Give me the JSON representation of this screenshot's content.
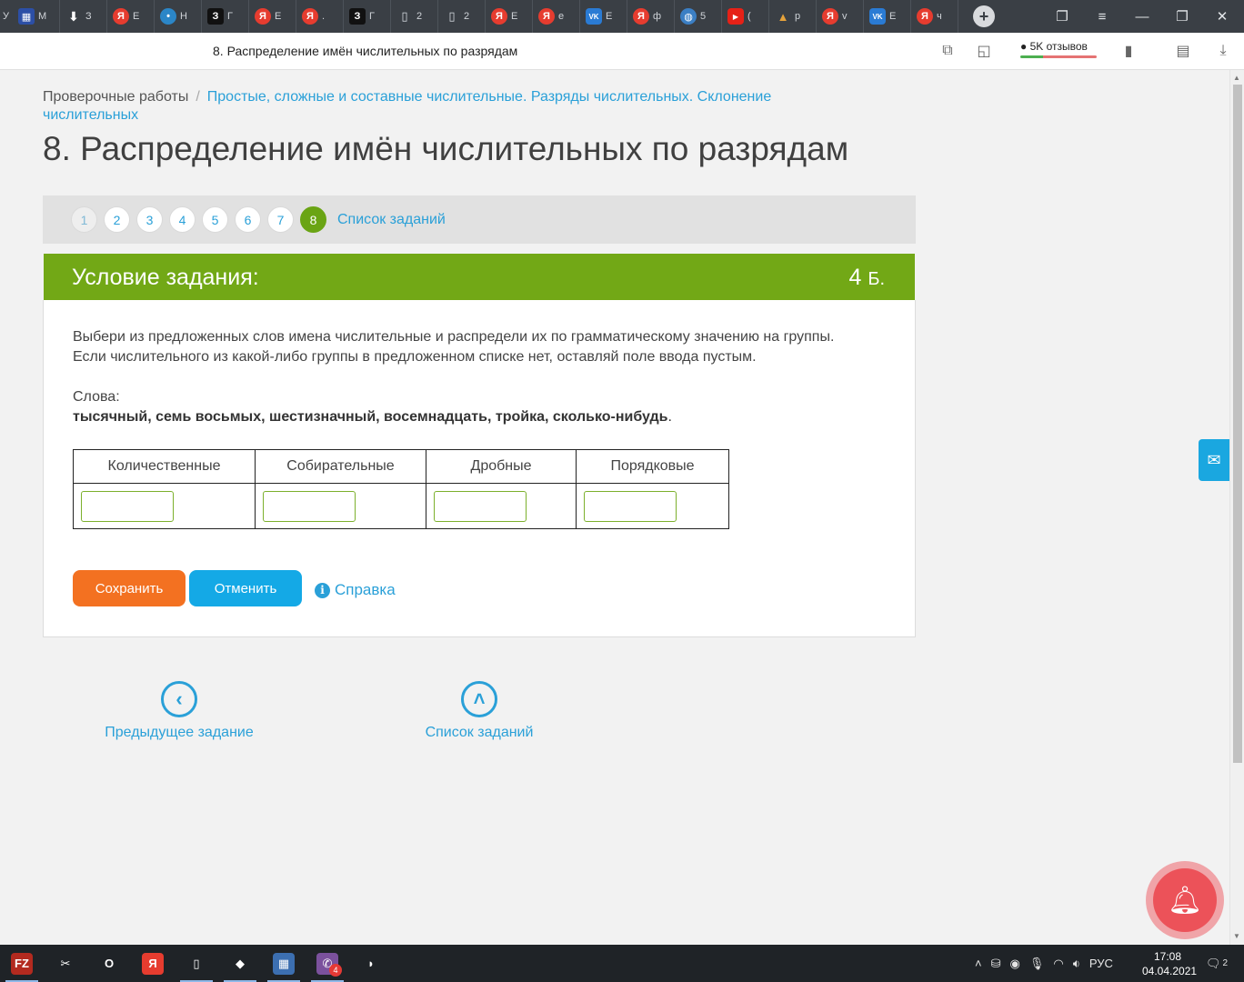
{
  "browser": {
    "tabs": [
      {
        "icon": "map-icon",
        "glyph": "▦",
        "cls": "blue",
        "label": "М"
      },
      {
        "icon": "download-icon",
        "glyph": "⬇",
        "cls": "dl",
        "label": "З"
      },
      {
        "icon": "yandex-icon",
        "glyph": "Я",
        "cls": "ya",
        "label": "Е"
      },
      {
        "icon": "lightbulb-icon",
        "glyph": "•",
        "cls": "bulb",
        "label": "Н"
      },
      {
        "icon": "z-icon",
        "glyph": "З",
        "cls": "z",
        "label": "Г"
      },
      {
        "icon": "yandex-icon",
        "glyph": "Я",
        "cls": "ya",
        "label": "Е"
      },
      {
        "icon": "yandex-icon",
        "glyph": "Я",
        "cls": "ya",
        "label": "."
      },
      {
        "icon": "z-icon",
        "glyph": "З",
        "cls": "z",
        "label": "Г"
      },
      {
        "icon": "document-icon",
        "glyph": "▯",
        "cls": "doc",
        "label": "2"
      },
      {
        "icon": "document-icon",
        "glyph": "▯",
        "cls": "doc",
        "label": "2"
      },
      {
        "icon": "yandex-icon",
        "glyph": "Я",
        "cls": "ya",
        "label": "Е"
      },
      {
        "icon": "yandex-icon",
        "glyph": "Я",
        "cls": "ya",
        "label": "е"
      },
      {
        "icon": "vk-icon",
        "glyph": "VK",
        "cls": "vk",
        "label": "Е"
      },
      {
        "icon": "yandex-icon",
        "glyph": "Я",
        "cls": "ya",
        "label": "ф"
      },
      {
        "icon": "globe-icon",
        "glyph": "◍",
        "cls": "globe",
        "label": "5"
      },
      {
        "icon": "youtube-icon",
        "glyph": "▶",
        "cls": "yt",
        "label": "("
      },
      {
        "icon": "triangle-icon",
        "glyph": "▲",
        "cls": "tri",
        "label": "р"
      },
      {
        "icon": "yandex-icon",
        "glyph": "Я",
        "cls": "ya",
        "label": "v"
      },
      {
        "icon": "vk-icon",
        "glyph": "VK",
        "cls": "vk",
        "label": "Е"
      },
      {
        "icon": "yandex-icon",
        "glyph": "Я",
        "cls": "ya",
        "label": "ч"
      }
    ],
    "tab_partial_label": "У",
    "page_title": "8. Распределение имён числительных по разрядам",
    "reviews_label": "5K отзывов"
  },
  "breadcrumb": {
    "root": "Проверочные работы",
    "separator": "/",
    "current": "Простые, сложные и составные числительные. Разряды числительных. Склонение числительных"
  },
  "heading": "8. Распределение имён числительных по разрядам",
  "pager": {
    "numbers": [
      "1",
      "2",
      "3",
      "4",
      "5",
      "6",
      "7",
      "8"
    ],
    "active": "8",
    "list_label": "Список заданий"
  },
  "task": {
    "title": "Условие задания:",
    "points_value": "4",
    "points_unit": "Б.",
    "instruction_line1": "Выбери из предложенных слов имена числительные и распредели их по грамматическому значению на группы.",
    "instruction_line2": "Если числительного из какой-либо группы в предложенном списке нет, оставляй поле ввода пустым.",
    "words_label": "Слова:",
    "words_list": "тысячный, семь восьмых, шестизначный, восемнадцать, тройка, сколько-нибудь",
    "words_end": ".",
    "columns": [
      "Количественные",
      "Собирательные",
      "Дробные",
      "Порядковые"
    ],
    "inputs": [
      "",
      "",
      "",
      ""
    ]
  },
  "actions": {
    "save": "Сохранить",
    "cancel": "Отменить",
    "help": "Справка"
  },
  "nav": {
    "prev": "Предыдущее задание",
    "list": "Список заданий"
  },
  "taskbar": {
    "apps": [
      {
        "icon": "filezilla-icon",
        "glyph": "FZ",
        "bg": "#b32a1f",
        "run": true
      },
      {
        "icon": "scissors-icon",
        "glyph": "✂",
        "bg": "transparent",
        "run": false
      },
      {
        "icon": "opera-icon",
        "glyph": "O",
        "bg": "transparent",
        "run": false
      },
      {
        "icon": "yandex-browser-icon",
        "glyph": "Я",
        "bg": "#e63c2f",
        "run": false
      },
      {
        "icon": "file-icon",
        "glyph": "▯",
        "bg": "transparent",
        "run": true
      },
      {
        "icon": "eraser-icon",
        "glyph": "◆",
        "bg": "transparent",
        "run": true
      },
      {
        "icon": "calculator-icon",
        "glyph": "▦",
        "bg": "#3c6fb1",
        "run": true
      },
      {
        "icon": "viber-icon",
        "glyph": "✆",
        "bg": "#7b519d",
        "run": true,
        "badge": "4"
      },
      {
        "icon": "app-icon",
        "glyph": "◗",
        "bg": "transparent",
        "run": false
      }
    ],
    "lang": "РУС",
    "time": "17:08",
    "date": "04.04.2021",
    "notifications": "2"
  }
}
